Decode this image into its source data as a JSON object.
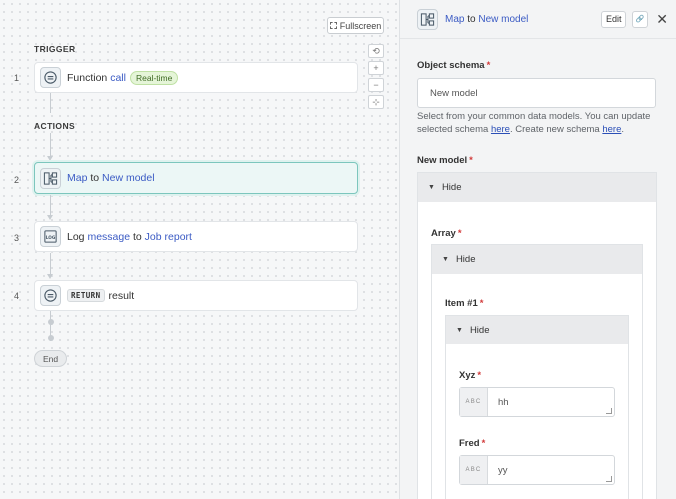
{
  "canvas": {
    "fullscreen_label": "Fullscreen",
    "trigger_label": "TRIGGER",
    "actions_label": "ACTIONS",
    "end_label": "End",
    "steps": [
      {
        "number": "1",
        "text": "Function",
        "keyword": "call",
        "badge": "Real-time",
        "icon": "trigger-function-icon"
      },
      {
        "number": "2",
        "text": "Map",
        "mid": "to",
        "keyword": "New model",
        "icon": "map-icon"
      },
      {
        "number": "3",
        "text": "Log",
        "keyword": "message",
        "mid": "to",
        "keyword2": "Job report",
        "icon": "log-icon"
      },
      {
        "number": "4",
        "tag": "RETURN",
        "text": "result",
        "icon": "return-icon"
      }
    ],
    "zoom_tools": [
      "⟲",
      "+",
      "−",
      "⊹"
    ]
  },
  "panel": {
    "title_a": "Map",
    "title_mid": "to",
    "title_b": "New model",
    "edit_label": "Edit",
    "link_icon": "🔗",
    "close_label": "✕",
    "object_schema": {
      "label": "Object schema",
      "required": "*",
      "value": "New model",
      "help_1": "Select from your common data models. You can update selected schema ",
      "help_link_1": "here",
      "help_2": ". Create new schema ",
      "help_link_2": "here",
      "help_3": "."
    },
    "new_model": {
      "label": "New model",
      "required": "*",
      "hide_label": "Hide",
      "array": {
        "label": "Array",
        "required": "*",
        "hide_label": "Hide",
        "item": {
          "label": "Item #1",
          "required": "*",
          "hide_label": "Hide",
          "fields": [
            {
              "label": "Xyz",
              "required": "*",
              "type_tag": "ABC",
              "value": "hh"
            },
            {
              "label": "Fred",
              "required": "*",
              "type_tag": "ABC",
              "value": "yy"
            }
          ]
        }
      }
    }
  },
  "colors": {
    "accent_teal": "#7cc6bd",
    "link_blue": "#3b5bc4",
    "required_red": "#d23b3b",
    "badge_green": "#e5f5d8"
  }
}
